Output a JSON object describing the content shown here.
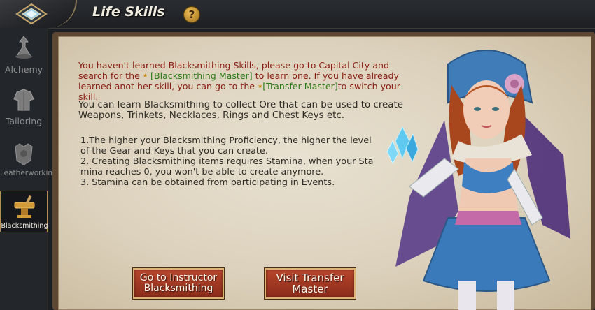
{
  "header": {
    "title": "Life Skills",
    "help_label": "?"
  },
  "sidebar": {
    "items": [
      {
        "label": "Alchemy",
        "icon": "alchemy-icon"
      },
      {
        "label": "Tailoring",
        "icon": "tailoring-icon"
      },
      {
        "label": "Leatherworking",
        "icon": "leatherworking-icon"
      },
      {
        "label": "Blacksmithing",
        "icon": "blacksmithing-icon",
        "active": true
      }
    ]
  },
  "notice": {
    "part1": "You haven't learned Blacksmithing Skills, please go to Capital City and search for the",
    "link1": "[Blacksmithing Master]",
    "part2": "to learn one. If you have already learned anot her skill, you can go to the",
    "link2": "[Transfer Master]",
    "part3": "to switch your skill."
  },
  "description": "You can learn Blacksmithing to collect Ore that can be used to create Weapons, Trinkets, Necklaces, Rings and Chest Keys etc.",
  "rules": [
    "1.The higher your Blacksmithing Proficiency, the higher the level of the Gear and Keys that you can create.",
    "2. Creating Blacksmithing items requires Stamina, when your Sta mina reaches 0, you won't be able to create anymore.",
    "3. Stamina can be obtained from participating in Events."
  ],
  "buttons": {
    "instructor_line1": "Go to Instructor",
    "instructor_line2": "Blacksmithing",
    "transfer_line1": "Visit Transfer",
    "transfer_line2": "Master"
  },
  "colors": {
    "warning_text": "#8a1e12",
    "link_text": "#2c7a18",
    "button_red": "#b8452c",
    "panel_parchment": "#e8e1d1"
  }
}
